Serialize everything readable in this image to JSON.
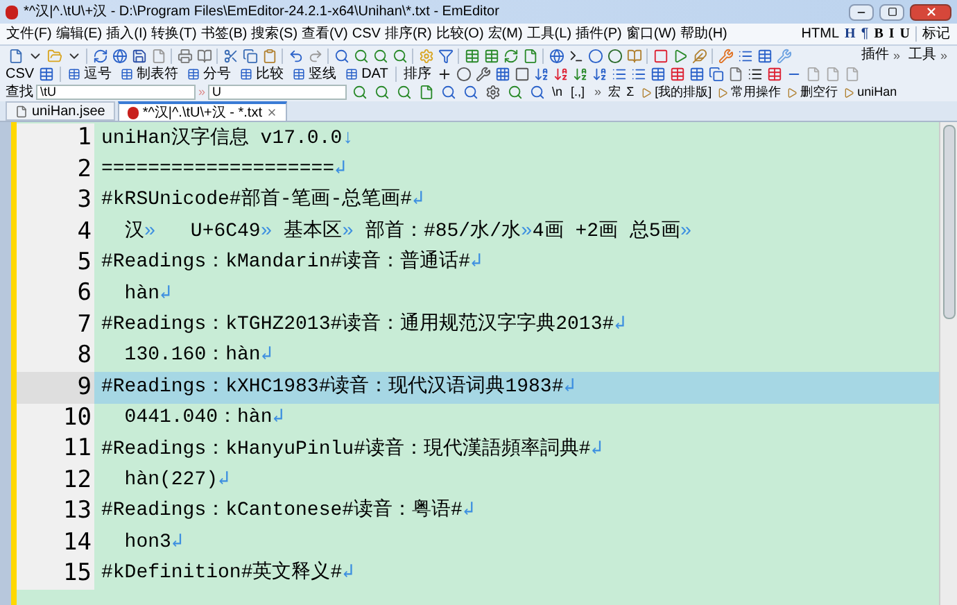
{
  "window": {
    "title": "*^汉|^.\\tU\\+汉 - D:\\Program Files\\EmEditor-24.2.1-x64\\Unihan\\*.txt - EmEditor"
  },
  "menu": [
    "文件(F)",
    "编辑(E)",
    "插入(I)",
    "转换(T)",
    "书签(B)",
    "搜索(S)",
    "查看(V)",
    "CSV",
    "排序(R)",
    "比较(O)",
    "宏(M)",
    "工具(L)",
    "插件(P)",
    "窗口(W)",
    "帮助(H)"
  ],
  "format_toolbar": {
    "items": [
      "HTML",
      "H",
      "¶",
      "B",
      "I",
      "U"
    ],
    "mark_label": "标记"
  },
  "toolbar_labels": [
    {
      "label": "插件",
      "more": "»"
    },
    {
      "label": "工具",
      "more": "»"
    }
  ],
  "csv_toolbar": {
    "label": "CSV",
    "buttons": [
      "逗号",
      "制表符",
      "分号",
      "比较",
      "竖线",
      "DAT"
    ],
    "sort_label": "排序"
  },
  "find_bar": {
    "label": "查找",
    "find_value": "\\tU",
    "separator": "»",
    "replace_value": "U",
    "escape_label": "\\n",
    "bracket_label": "[.,]",
    "macro_label": "宏",
    "sum_label": "Σ",
    "macros": [
      "[我的排版]",
      "常用操作",
      "删空行",
      "uniHan"
    ],
    "more": "»"
  },
  "tabs": [
    {
      "label": "uniHan.jsee",
      "selected": false
    },
    {
      "label": "*^汉|^.\\tU\\+汉 - *.txt",
      "selected": true
    }
  ],
  "editor": {
    "lines": [
      {
        "number": "1",
        "selected": false,
        "segments": [
          {
            "kind": "text",
            "text": "uniHan汉字信息 v17.0.0"
          },
          {
            "kind": "mark",
            "text": "↓"
          }
        ]
      },
      {
        "number": "2",
        "selected": false,
        "segments": [
          {
            "kind": "text",
            "text": "===================="
          },
          {
            "kind": "mark",
            "text": "↲"
          }
        ]
      },
      {
        "number": "3",
        "selected": false,
        "segments": [
          {
            "kind": "text",
            "text": "#kRSUnicode#部首-笔画-总笔画#"
          },
          {
            "kind": "mark",
            "text": "↲"
          }
        ]
      },
      {
        "number": "4",
        "selected": false,
        "segments": [
          {
            "kind": "text",
            "text": "  汉"
          },
          {
            "kind": "mark",
            "text": "»"
          },
          {
            "kind": "text",
            "text": "   U+6C49"
          },
          {
            "kind": "mark",
            "text": "»"
          },
          {
            "kind": "text",
            "text": " 基本区"
          },
          {
            "kind": "mark",
            "text": "»"
          },
          {
            "kind": "text",
            "text": " 部首：#85/水/水"
          },
          {
            "kind": "mark",
            "text": "»"
          },
          {
            "kind": "text",
            "text": "4画 +2画 总5画"
          },
          {
            "kind": "mark",
            "text": "»"
          }
        ]
      },
      {
        "number": "5",
        "selected": false,
        "segments": [
          {
            "kind": "text",
            "text": "#Readings：kMandarin#读音：普通话#"
          },
          {
            "kind": "mark",
            "text": "↲"
          }
        ]
      },
      {
        "number": "6",
        "selected": false,
        "segments": [
          {
            "kind": "text",
            "text": "  hàn"
          },
          {
            "kind": "mark",
            "text": "↲"
          }
        ]
      },
      {
        "number": "7",
        "selected": false,
        "segments": [
          {
            "kind": "text",
            "text": "#Readings：kTGHZ2013#读音：通用规范汉字字典2013#"
          },
          {
            "kind": "mark",
            "text": "↲"
          }
        ]
      },
      {
        "number": "8",
        "selected": false,
        "segments": [
          {
            "kind": "text",
            "text": "  130.160：hàn"
          },
          {
            "kind": "mark",
            "text": "↲"
          }
        ]
      },
      {
        "number": "9",
        "selected": true,
        "segments": [
          {
            "kind": "text",
            "text": "#Readings：kXHC1983#读音：现代汉语词典1983#"
          },
          {
            "kind": "mark",
            "text": "↲"
          }
        ]
      },
      {
        "number": "10",
        "selected": false,
        "segments": [
          {
            "kind": "text",
            "text": "  0441.040：hàn"
          },
          {
            "kind": "mark",
            "text": "↲"
          }
        ]
      },
      {
        "number": "11",
        "selected": false,
        "segments": [
          {
            "kind": "text",
            "text": "#Readings：kHanyuPinlu#读音：現代漢語頻率詞典#"
          },
          {
            "kind": "mark",
            "text": "↲"
          }
        ]
      },
      {
        "number": "12",
        "selected": false,
        "segments": [
          {
            "kind": "text",
            "text": "  hàn(227)"
          },
          {
            "kind": "mark",
            "text": "↲"
          }
        ]
      },
      {
        "number": "13",
        "selected": false,
        "segments": [
          {
            "kind": "text",
            "text": "#Readings：kCantonese#读音：粤语#"
          },
          {
            "kind": "mark",
            "text": "↲"
          }
        ]
      },
      {
        "number": "14",
        "selected": false,
        "segments": [
          {
            "kind": "text",
            "text": "  hon3"
          },
          {
            "kind": "mark",
            "text": "↲"
          }
        ]
      },
      {
        "number": "15",
        "selected": false,
        "segments": [
          {
            "kind": "text",
            "text": "#kDefinition#英文释义#"
          },
          {
            "kind": "mark",
            "text": "↲"
          }
        ]
      }
    ]
  }
}
